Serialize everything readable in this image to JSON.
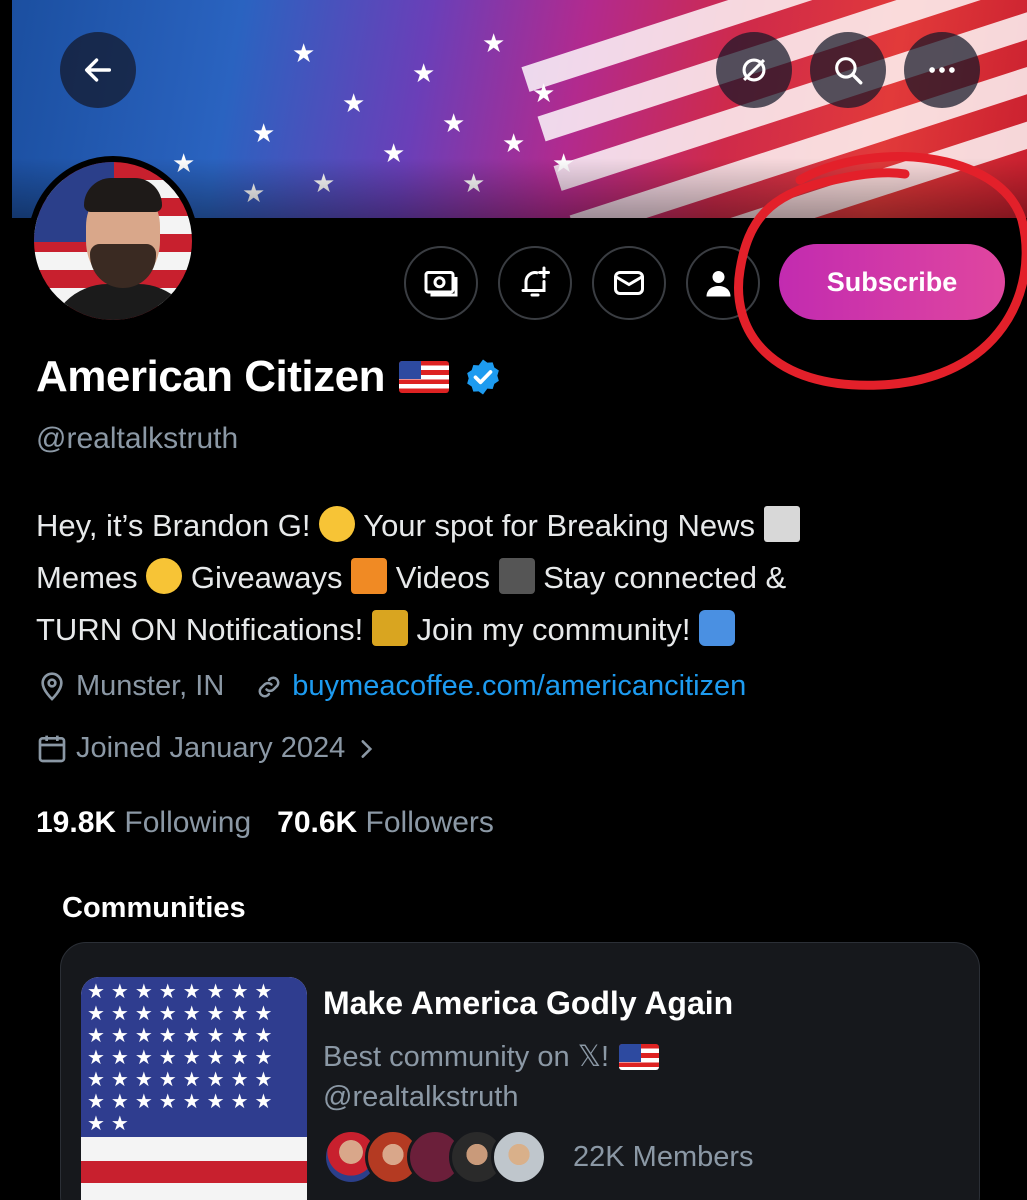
{
  "header": {
    "back_icon": "arrow-left-icon",
    "action_icons": [
      "slashed-circle-icon",
      "search-icon",
      "more-icon"
    ]
  },
  "profile": {
    "display_name": "American Citizen",
    "handle": "@realtalkstruth",
    "verified": true,
    "bio_line1_a": "Hey, it’s Brandon G!",
    "bio_line1_b": "Your spot for Breaking News",
    "bio_line2_a": "Memes",
    "bio_line2_b": "Giveaways",
    "bio_line2_c": "Videos",
    "bio_line2_d": "Stay connected &",
    "bio_line3_a": "TURN ON Notifications!",
    "bio_line3_b": "Join my community!",
    "location": "Munster, IN",
    "website": "buymeacoffee.com/americancitizen",
    "joined": "Joined January 2024",
    "following_count": "19.8K",
    "following_label": "Following",
    "followers_count": "70.6K",
    "followers_label": "Followers"
  },
  "actions": {
    "subscribe_label": "Subscribe",
    "icons": [
      "money-icon",
      "bell-plus-icon",
      "mail-icon",
      "follow-user-icon"
    ]
  },
  "communities": {
    "title": "Communities",
    "items": [
      {
        "name": "Make America Godly Again",
        "description": "Best community on 𝕏!",
        "handle": "@realtalkstruth",
        "members": "22K Members"
      }
    ]
  },
  "colors": {
    "accent_blue": "#1d9bf0",
    "subscribe_gradient_start": "#c22bb0",
    "subscribe_gradient_end": "#e0469f",
    "annotation_red": "#e3202a"
  }
}
